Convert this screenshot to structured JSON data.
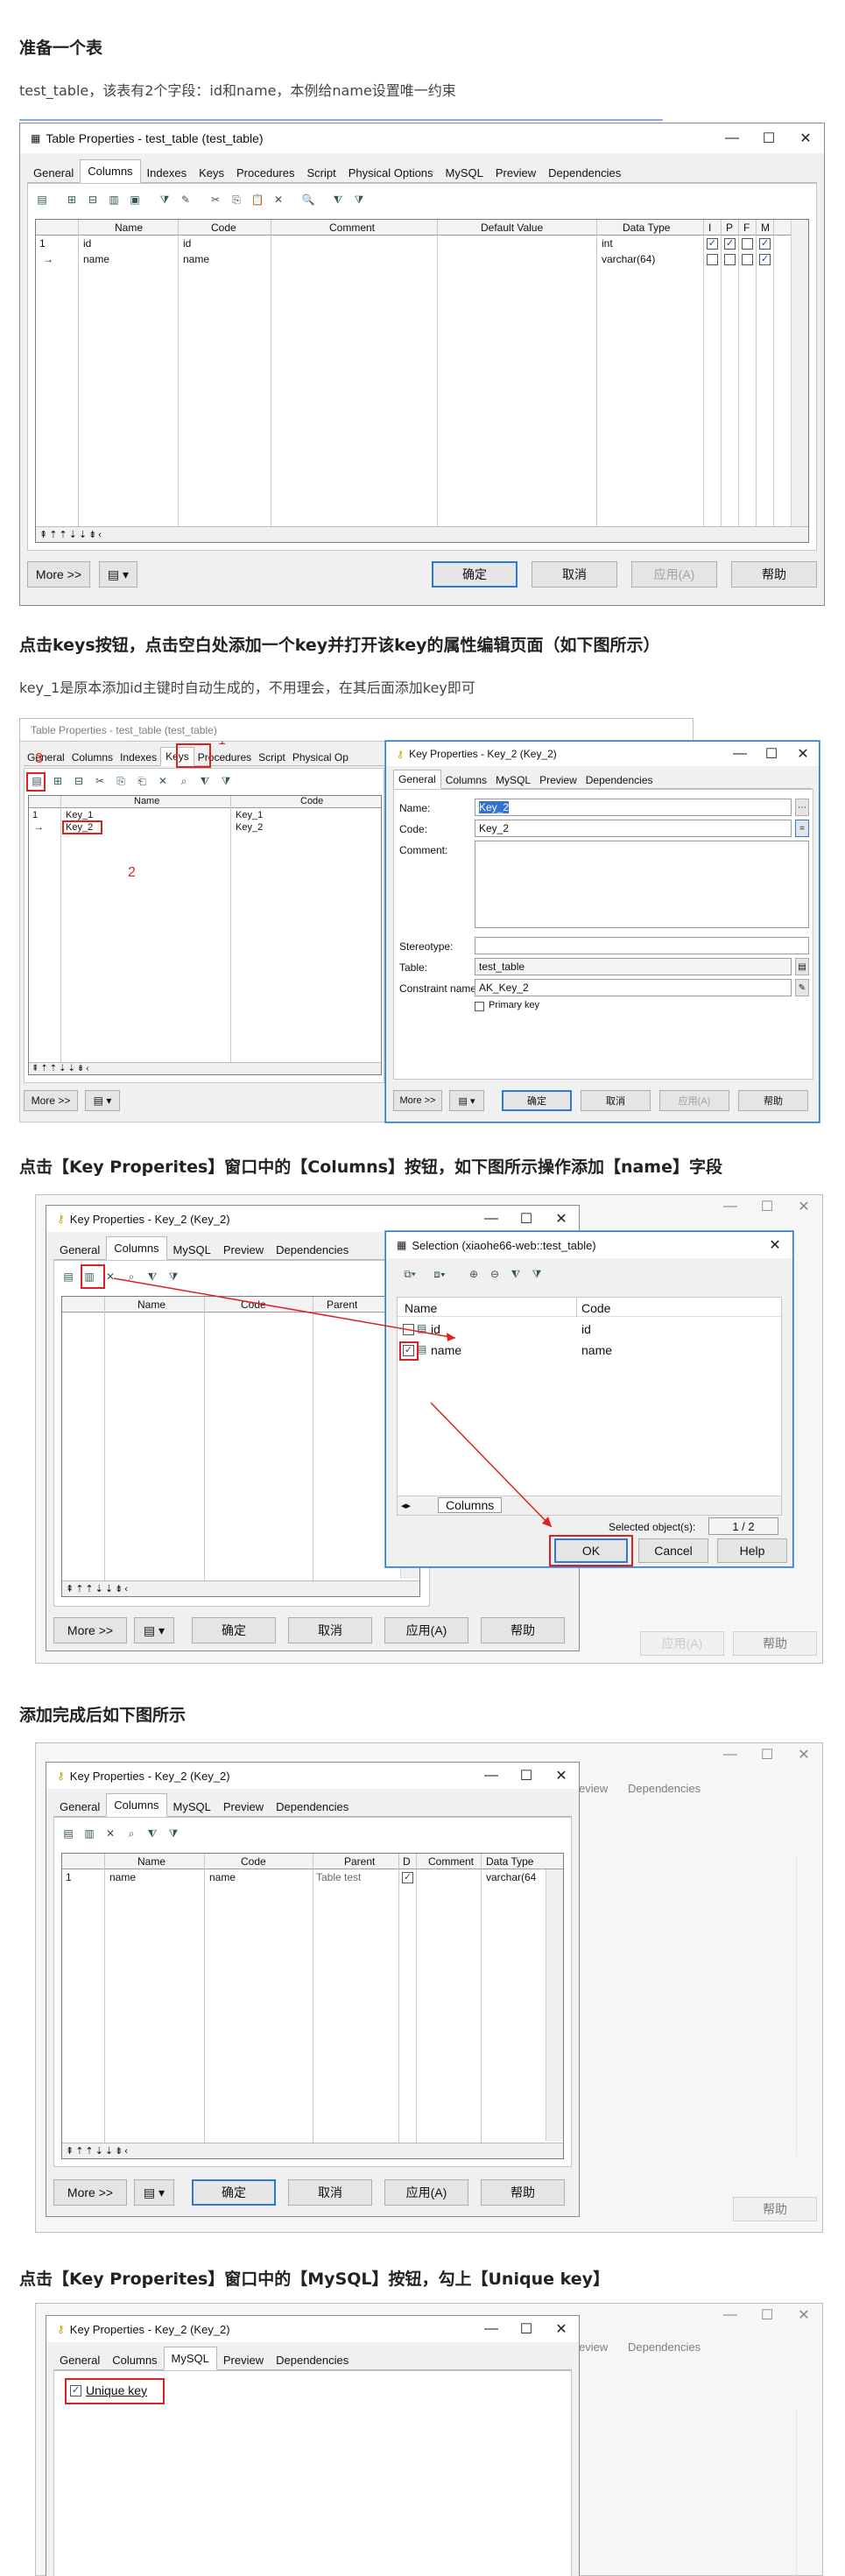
{
  "sections": {
    "s1": {
      "heading": "准备一个表",
      "text": "test_table，该表有2个字段：id和name，本例给name设置唯一约束"
    },
    "s2": {
      "heading": "点击keys按钮，点击空白处添加一个key并打开该key的属性编辑页面（如下图所示）",
      "text": "key_1是原本添加id主键时自动生成的，不用理会，在其后面添加key即可"
    },
    "s3": {
      "heading": "点击【Key Properites】窗口中的【Columns】按钮，如下图所示操作添加【name】字段"
    },
    "s4": {
      "heading": "添加完成后如下图所示"
    },
    "s5": {
      "heading": "点击【Key Properites】窗口中的【MySQL】按钮，勾上【Unique key】"
    }
  },
  "table_props": {
    "title": "Table Properties - test_table (test_table)",
    "title_faded": "Table Properties - test_table (test_table)",
    "tabs": [
      "General",
      "Columns",
      "Indexes",
      "Keys",
      "Procedures",
      "Script",
      "Physical Options",
      "MySQL",
      "Preview",
      "Dependencies"
    ],
    "active_tab": "Columns",
    "columns_headers": [
      "Name",
      "Code",
      "Comment",
      "Default Value",
      "Data Type",
      "I",
      "P",
      "F",
      "M"
    ],
    "columns_rows": [
      {
        "num": "1",
        "name": "id",
        "code": "id",
        "type": "int"
      },
      {
        "num": "→",
        "name": "name",
        "code": "name",
        "type": "varchar(64)"
      }
    ],
    "more": "More >>",
    "ok": "确定",
    "cancel": "取消",
    "apply": "应用(A)",
    "help": "帮助"
  },
  "keys_panel": {
    "tabs": [
      "General",
      "Columns",
      "Indexes",
      "Keys",
      "Procedures",
      "Script",
      "Physical Op"
    ],
    "headers": [
      "Name",
      "Code"
    ],
    "rows": [
      {
        "num": "1",
        "name": "Key_1",
        "code": "Key_1"
      },
      {
        "num": "→",
        "name": "Key_2",
        "code": "Key_2"
      }
    ],
    "marks": [
      "1",
      "2",
      "3"
    ],
    "more": "More >>"
  },
  "key_props": {
    "title": "Key Properties - Key_2 (Key_2)",
    "tabs_general": [
      "General",
      "Columns",
      "MySQL",
      "Preview",
      "Dependencies"
    ],
    "name_label": "Name:",
    "name_value": "Key_2",
    "code_label": "Code:",
    "code_value": "Key_2",
    "comment_label": "Comment:",
    "stereotype_label": "Stereotype:",
    "table_label": "Table:",
    "table_value": "test_table",
    "constraint_label": "Constraint name:",
    "constraint_value": "AK_Key_2",
    "primary_label": "Primary key",
    "col_headers": [
      "Name",
      "Code",
      "Parent",
      "D",
      "Comment",
      "Data Type"
    ],
    "col_row": {
      "num": "1",
      "name": "name",
      "code": "name",
      "parent": "Table test",
      "type": "varchar(64"
    },
    "more": "More >>",
    "ok": "确定",
    "cancel": "取消",
    "apply": "应用(A)",
    "help": "帮助",
    "unique_key": "Unique key"
  },
  "selection": {
    "title": "Selection (xiaohe66-web::test_table)",
    "headers": [
      "Name",
      "Code"
    ],
    "rows": [
      {
        "name": "id",
        "code": "id",
        "checked": false
      },
      {
        "name": "name",
        "code": "name",
        "checked": true
      }
    ],
    "tab": "Columns",
    "selected_label": "Selected object(s):",
    "selected_count": "1 / 2",
    "ok": "OK",
    "cancel": "Cancel",
    "help": "Help"
  },
  "bg_dialog": {
    "tabs_tail": [
      "eview",
      "Dependencies"
    ]
  },
  "colors": {
    "accent": "#2b7bd6",
    "annotation": "#e02020"
  }
}
